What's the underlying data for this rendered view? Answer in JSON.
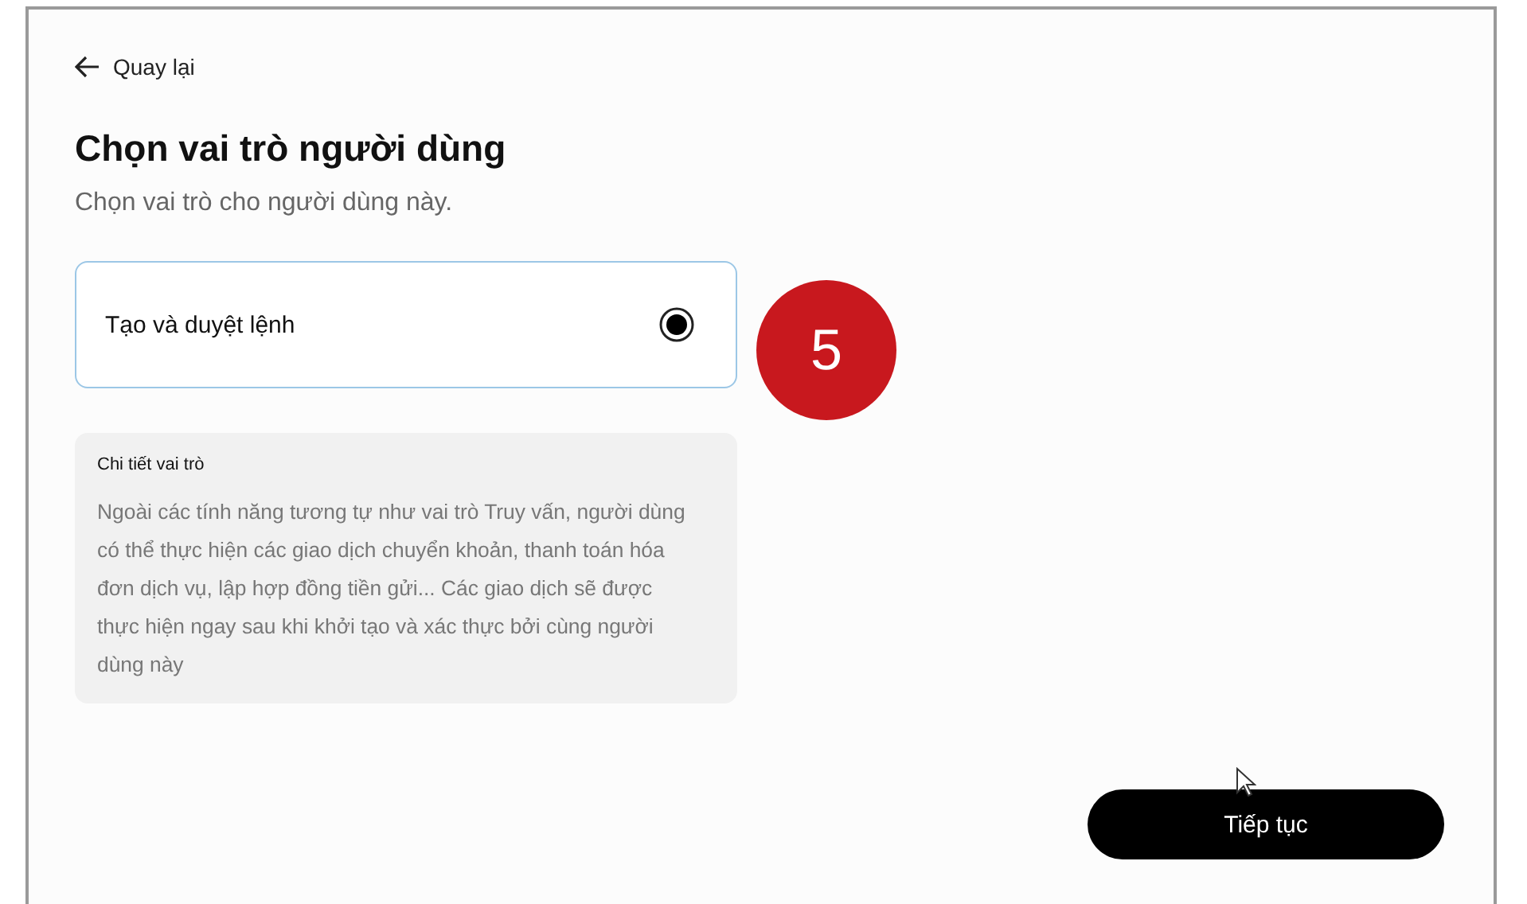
{
  "back_link": {
    "label": "Quay lại"
  },
  "title": "Chọn vai trò người dùng",
  "subtitle": "Chọn vai trò cho người dùng này.",
  "roles": [
    {
      "label": "Tạo và duyệt lệnh",
      "selected": true
    }
  ],
  "role_details": {
    "heading": "Chi tiết vai trò",
    "text": "Ngoài các tính năng tương tự như vai trò Truy vấn, người dùng có thể thực hiện các giao dịch chuyển khoản, thanh toán hóa đơn dịch vụ, lập hợp đồng tiền gửi... Các giao dịch sẽ được thực hiện ngay sau khi khởi tạo và xác thực bởi cùng người dùng này"
  },
  "step_badge": "5",
  "continue_button": "Tiếp tục"
}
